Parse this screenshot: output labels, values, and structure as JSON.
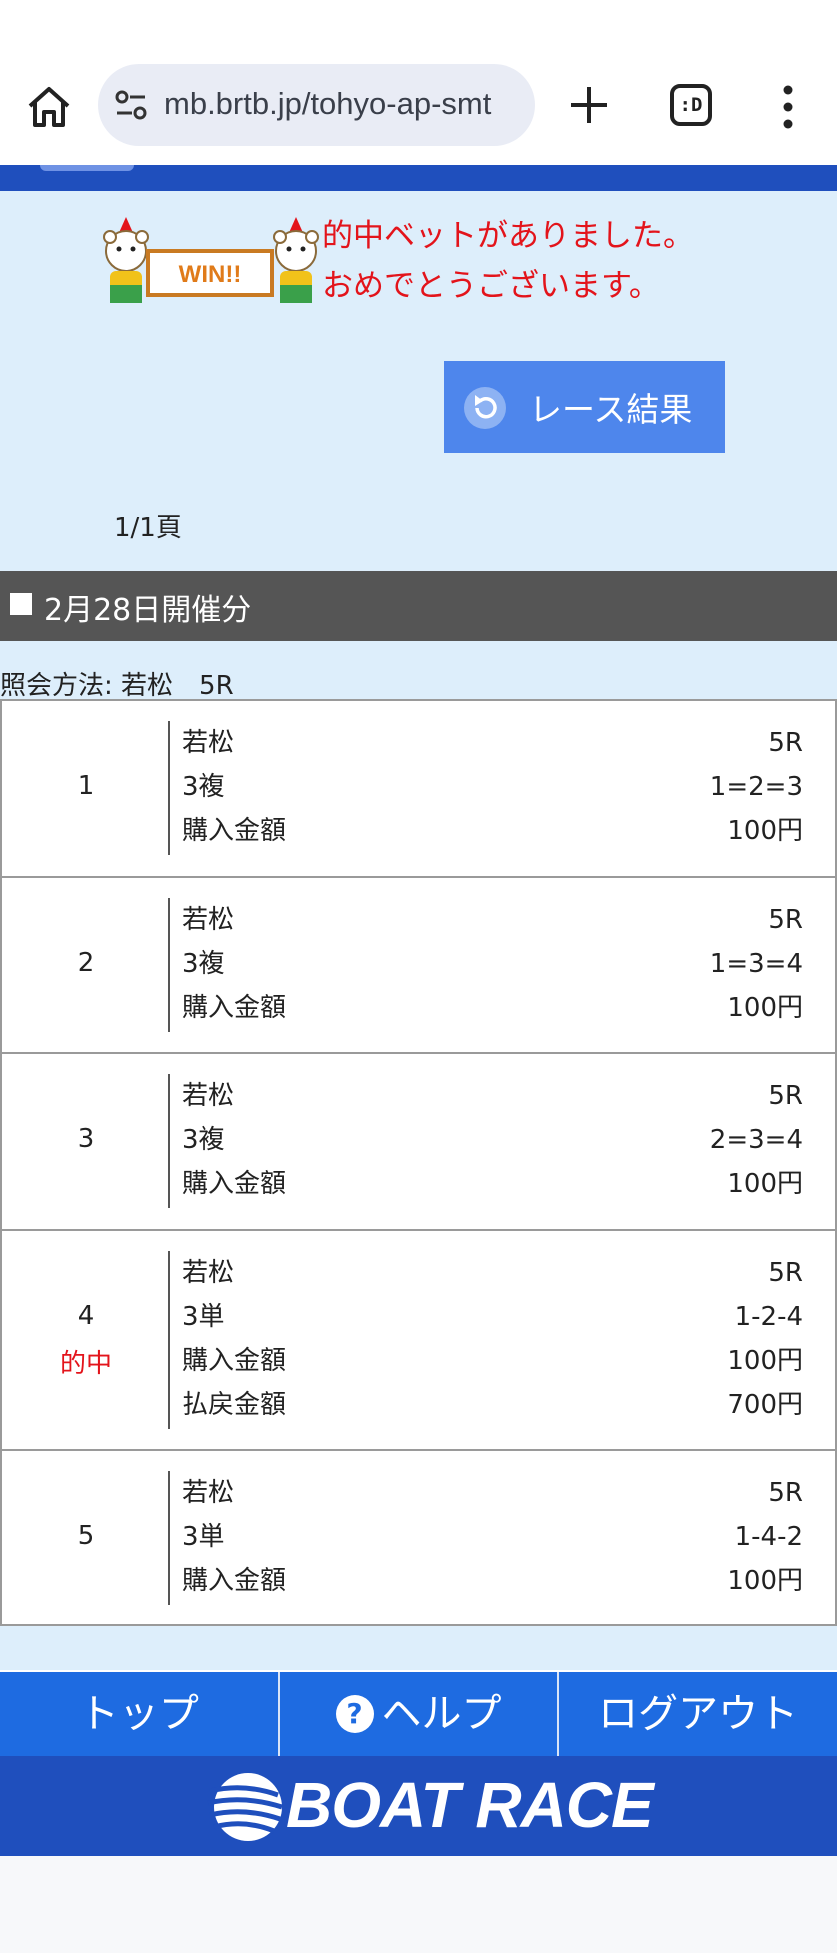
{
  "browser": {
    "url": "mb.brtb.jp/tohyo-ap-smt",
    "tabs_label": ":D",
    "icons": [
      "home-icon",
      "site-info-icon",
      "new-tab-icon",
      "tab-switcher-icon",
      "more-menu-icon"
    ]
  },
  "banner": {
    "win_text": "WIN!!",
    "message_line1": "的中ベットがありました。",
    "message_line2": "おめでとうございます。"
  },
  "actions": {
    "race_result_label": "レース結果"
  },
  "pagination": {
    "label": "1/1頁"
  },
  "section": {
    "date_header": "2月28日開催分"
  },
  "query": {
    "text": "照会方法: 若松　5R"
  },
  "bets": [
    {
      "num": "1",
      "hit": "",
      "rows": [
        {
          "label": "若松",
          "value": "5R"
        },
        {
          "label": "3複",
          "value": "1=2=3"
        },
        {
          "label": "購入金額",
          "value": "100円"
        }
      ]
    },
    {
      "num": "2",
      "hit": "",
      "rows": [
        {
          "label": "若松",
          "value": "5R"
        },
        {
          "label": "3複",
          "value": "1=3=4"
        },
        {
          "label": "購入金額",
          "value": "100円"
        }
      ]
    },
    {
      "num": "3",
      "hit": "",
      "rows": [
        {
          "label": "若松",
          "value": "5R"
        },
        {
          "label": "3複",
          "value": "2=3=4"
        },
        {
          "label": "購入金額",
          "value": "100円"
        }
      ]
    },
    {
      "num": "4",
      "hit": "的中",
      "rows": [
        {
          "label": "若松",
          "value": "5R"
        },
        {
          "label": "3単",
          "value": "1-2-4"
        },
        {
          "label": "購入金額",
          "value": "100円"
        },
        {
          "label": "払戻金額",
          "value": "700円"
        }
      ]
    },
    {
      "num": "5",
      "hit": "",
      "rows": [
        {
          "label": "若松",
          "value": "5R"
        },
        {
          "label": "3単",
          "value": "1-4-2"
        },
        {
          "label": "購入金額",
          "value": "100円"
        }
      ]
    }
  ],
  "bottom_nav": {
    "top": "トップ",
    "help_icon": "?",
    "help": "ヘルプ",
    "logout": "ログアウト"
  },
  "footer": {
    "logo": "BOAT RACE"
  },
  "colors": {
    "brand_blue": "#1f4fbd",
    "nav_blue": "#1e6be1",
    "button_blue": "#4e86ec",
    "content_bg": "#ddeefb",
    "hit_red": "#e3141b"
  }
}
